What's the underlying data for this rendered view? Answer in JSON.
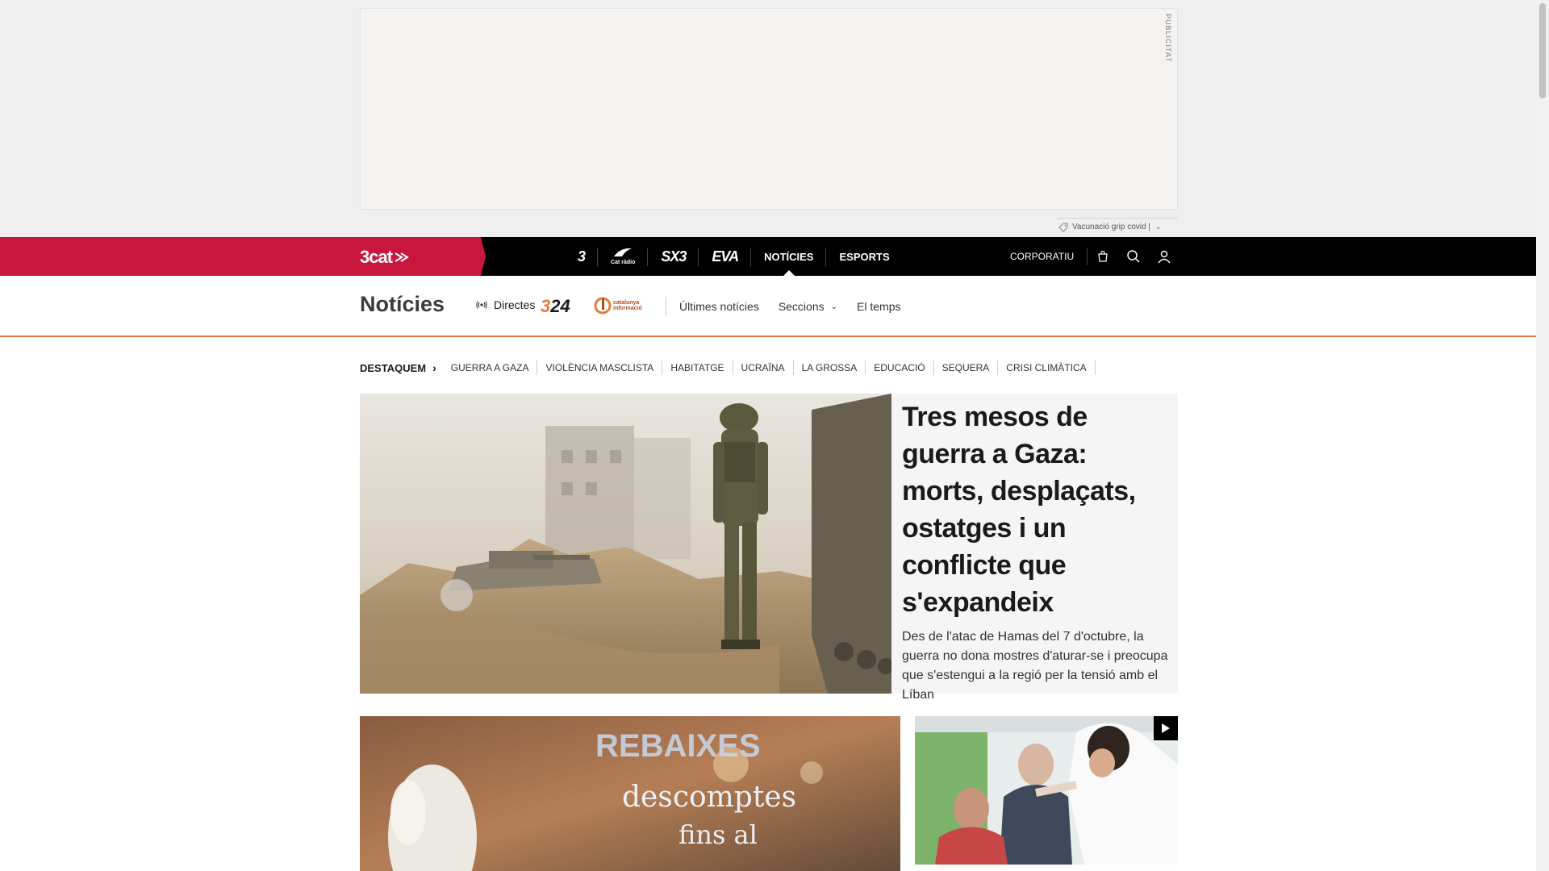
{
  "ad": {
    "label": "PUBLICITAT"
  },
  "alert": {
    "text": "Vacunació grip covid |",
    "icon": "tag-icon"
  },
  "topnav": {
    "brand": "3cat",
    "channels": [
      {
        "name": "3",
        "kind": "logo"
      },
      {
        "name": "Cat ràdio",
        "kind": "radio"
      },
      {
        "name": "SX3",
        "kind": "logo"
      },
      {
        "name": "EVA",
        "kind": "logo"
      },
      {
        "name": "NOTÍCIES",
        "kind": "text",
        "active": true
      },
      {
        "name": "ESPORTS",
        "kind": "text"
      }
    ],
    "corporate": "CORPORATIU",
    "icons": [
      "shop-icon",
      "search-icon",
      "user-icon"
    ]
  },
  "section": {
    "title": "Notícies",
    "directes": "Directes",
    "logo_324_a": "3",
    "logo_324_b": "24",
    "logo_ci": "catalunya informació",
    "links": {
      "latest": "Últimes notícies",
      "sections": "Seccions",
      "weather": "El temps"
    }
  },
  "destaquem": {
    "label": "DESTAQUEM",
    "topics": [
      "GUERRA A GAZA",
      "VIOLÈNCIA MASCLISTA",
      "HABITATGE",
      "UCRAÏNA",
      "LA GROSSA",
      "EDUCACIÓ",
      "SEQUERA",
      "CRISI CLIMÀTICA"
    ]
  },
  "lead": {
    "headline": "Tres mesos de guerra a Gaza: morts, desplaçats, ostatges i un conflicte que s'expandeix",
    "summary": "Des de l'atac de Hamas del 7 d'octubre, la guerra no dona mostres d'aturar-se i preocupa que s'estengui a la regió per la tensió amb el Líban"
  },
  "card1": {
    "sign_top": "REBAIXES",
    "sign_mid": "descomptes",
    "sign_bot": "fins al"
  },
  "colors": {
    "brand": "#c8163f",
    "accent": "#e77a3b",
    "nav_bg": "#000000"
  }
}
